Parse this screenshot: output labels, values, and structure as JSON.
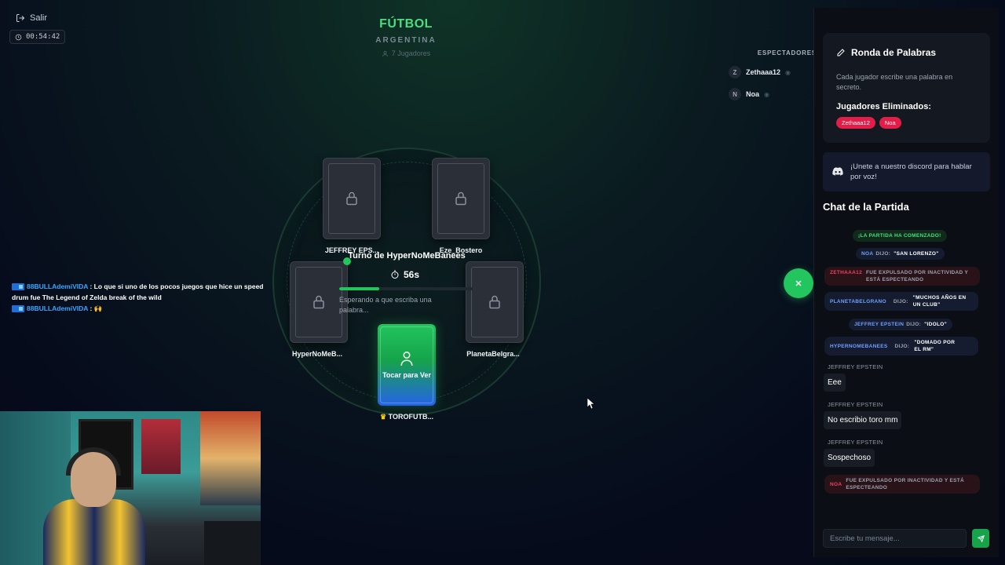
{
  "top_left": {
    "exit_label": "Salir",
    "elapsed_time": "00:54:42"
  },
  "game": {
    "category": "FÚTBOL",
    "word": "ARGENTINA",
    "players_count": "7 Jugadores"
  },
  "spectators": {
    "title": "ESPECTADORES",
    "items": [
      {
        "initial": "Z",
        "name": "Zethaaa12"
      },
      {
        "initial": "N",
        "name": "Noa"
      }
    ]
  },
  "table": {
    "players": [
      {
        "name": "JEFFREY EPS..."
      },
      {
        "name": "Eze_Bostero"
      },
      {
        "name": "HyperNoMeB..."
      },
      {
        "name": "PlanetaBelgra..."
      }
    ],
    "turn_text": "Turno de HyperNoMeBanees",
    "countdown": "56s",
    "progress_fraction": 0.3,
    "waiting_text": "Esperando a que escriba una palabra...",
    "my_card": {
      "action_text": "Tocar para Ver",
      "owner": "TOROFUTB..."
    }
  },
  "stream_chat": [
    {
      "user": "88BULLAdemiVIDA",
      "message": "Lo que si uno de los pocos juegos que hice un speed drum fue The Legend of Zelda break of the wild"
    },
    {
      "user": "88BULLAdemiVIDA",
      "message": "🙌"
    }
  ],
  "panel": {
    "round": {
      "title": "Ronda de Palabras",
      "description": "Cada jugador escribe una palabra en secreto.",
      "eliminated_title": "Jugadores Eliminados:",
      "eliminated": [
        "Zethaaa12",
        "Noa"
      ]
    },
    "discord_text": "¡Unete a nuestro discord para hablar por voz!",
    "chat_title": "Chat de la Partida",
    "messages": {
      "started": "¡LA PARTIDA HA COMENZADO!",
      "noa_user": "NOA",
      "noa_said": "DIJO:",
      "noa_text": "\"SAN LORENZO\"",
      "zeth_user": "ZETHAAA12",
      "zeth_text": "FUE EXPULSADO POR INACTIVIDAD Y ESTÁ ESPECTEANDO",
      "planeta_user": "PLANETABELGRANO",
      "planeta_said": "DIJO:",
      "planeta_text": "\"MUCHOS AÑOS EN UN CLUB\"",
      "jeff_user": "JEFFREY EPSTEIN",
      "jeff_said": "DIJO:",
      "jeff_text": "\"IDOLO\"",
      "hyper_user": "HYPERNOMEBANEES",
      "hyper_said": "DIJO:",
      "hyper_text": "\"DOMADO POR EL RM\"",
      "chat1_user": "JEFFREY EPSTEIN",
      "chat1_text": "Eee",
      "chat2_user": "JEFFREY EPSTEIN",
      "chat2_text": "No escribio toro mm",
      "chat3_user": "JEFFREY EPSTEIN",
      "chat3_text": "Sospechoso",
      "noa2_user": "NOA",
      "noa2_text": "FUE EXPULSADO POR INACTIVIDAD Y ESTÁ ESPECTEANDO"
    },
    "input_placeholder": "Escribe tu mensaje..."
  },
  "colors": {
    "accent_green": "#22c55e",
    "danger_red": "#e11d48",
    "link_blue": "#3aa6ff"
  }
}
